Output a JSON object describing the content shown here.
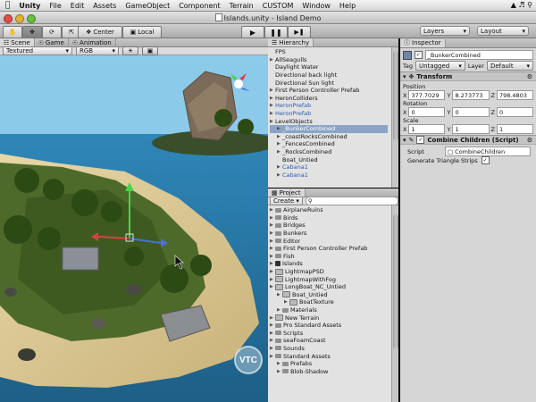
{
  "menubar": {
    "apple": "",
    "items": [
      "Unity",
      "File",
      "Edit",
      "Assets",
      "GameObject",
      "Component",
      "Terrain",
      "CUSTOM",
      "Window",
      "Help"
    ],
    "right_status": "◂ ▸ ◉"
  },
  "window": {
    "title": "Islands.unity - Island Demo"
  },
  "toolbar": {
    "pivot_label": "Center",
    "space_label": "Local",
    "layers_label": "Layers",
    "layout_label": "Layout"
  },
  "scene_panel": {
    "tabs": [
      "Scene",
      "Game",
      "Animation"
    ],
    "render_mode": "Textured",
    "color_mode": "RGB",
    "watermark": "VTC"
  },
  "hierarchy": {
    "title": "Hierarchy",
    "rows": [
      {
        "label": "FPS",
        "indent": 0,
        "arrow": false,
        "blue": false,
        "selected": false
      },
      {
        "label": "AllSeagulls",
        "indent": 0,
        "arrow": true,
        "blue": false,
        "selected": false
      },
      {
        "label": "Daylight Water",
        "indent": 0,
        "arrow": false,
        "blue": false,
        "selected": false
      },
      {
        "label": "Directional back light",
        "indent": 0,
        "arrow": false,
        "blue": false,
        "selected": false
      },
      {
        "label": "Directional Sun light",
        "indent": 0,
        "arrow": false,
        "blue": false,
        "selected": false
      },
      {
        "label": "First Person Controller Prefab",
        "indent": 0,
        "arrow": true,
        "blue": false,
        "selected": false
      },
      {
        "label": "HeronColliders",
        "indent": 0,
        "arrow": true,
        "blue": false,
        "selected": false
      },
      {
        "label": "HeronPrefab",
        "indent": 0,
        "arrow": true,
        "blue": true,
        "selected": false
      },
      {
        "label": "HeronPrefab",
        "indent": 0,
        "arrow": true,
        "blue": true,
        "selected": false
      },
      {
        "label": "LevelObjects",
        "indent": 0,
        "arrow": true,
        "blue": false,
        "selected": false
      },
      {
        "label": "_BunkerCombined",
        "indent": 1,
        "arrow": true,
        "blue": false,
        "selected": true
      },
      {
        "label": "_coastRocksCombined",
        "indent": 1,
        "arrow": true,
        "blue": false,
        "selected": false
      },
      {
        "label": "_FencesCombined",
        "indent": 1,
        "arrow": true,
        "blue": false,
        "selected": false
      },
      {
        "label": "_RocksCombined",
        "indent": 1,
        "arrow": true,
        "blue": false,
        "selected": false
      },
      {
        "label": "Boat_Untied",
        "indent": 1,
        "arrow": false,
        "blue": false,
        "selected": false
      },
      {
        "label": "Cabana1",
        "indent": 1,
        "arrow": true,
        "blue": true,
        "selected": false
      },
      {
        "label": "Cabana1",
        "indent": 1,
        "arrow": true,
        "blue": true,
        "selected": false
      }
    ]
  },
  "project": {
    "title": "Project",
    "create_label": "Create",
    "rows": [
      {
        "label": "AirplaneRuins",
        "indent": 0,
        "kind": "folder"
      },
      {
        "label": "Birds",
        "indent": 0,
        "kind": "folder"
      },
      {
        "label": "Bridges",
        "indent": 0,
        "kind": "folder"
      },
      {
        "label": "Bunkers",
        "indent": 0,
        "kind": "folder"
      },
      {
        "label": "Editor",
        "indent": 0,
        "kind": "folder"
      },
      {
        "label": "First Person Controller Prefab",
        "indent": 0,
        "kind": "folder"
      },
      {
        "label": "Fish",
        "indent": 0,
        "kind": "folder"
      },
      {
        "label": "Islands",
        "indent": 0,
        "kind": "scene"
      },
      {
        "label": "LightmapPSD",
        "indent": 0,
        "kind": "file"
      },
      {
        "label": "LightmapWithFog",
        "indent": 0,
        "kind": "file"
      },
      {
        "label": "LongBoat_NC_Untied",
        "indent": 0,
        "kind": "file"
      },
      {
        "label": "Boat_Untied",
        "indent": 1,
        "kind": "file"
      },
      {
        "label": "BoatTexture",
        "indent": 2,
        "kind": "file"
      },
      {
        "label": "Materials",
        "indent": 1,
        "kind": "folder"
      },
      {
        "label": "New Terrain",
        "indent": 0,
        "kind": "file"
      },
      {
        "label": "Pro Standard Assets",
        "indent": 0,
        "kind": "folder"
      },
      {
        "label": "Scripts",
        "indent": 0,
        "kind": "folder"
      },
      {
        "label": "seaFoamCoast",
        "indent": 0,
        "kind": "folder"
      },
      {
        "label": "Sounds",
        "indent": 0,
        "kind": "folder"
      },
      {
        "label": "Standard Assets",
        "indent": 0,
        "kind": "folder"
      },
      {
        "label": "Prefabs",
        "indent": 1,
        "kind": "folder"
      },
      {
        "label": "Blob-Shadow",
        "indent": 1,
        "kind": "folder"
      }
    ]
  },
  "inspector": {
    "title": "Inspector",
    "object_name": "_BunkerCombined",
    "tag_label": "Tag",
    "tag_value": "Untagged",
    "layer_label": "Layer",
    "layer_value": "Default",
    "transform": {
      "title": "Transform",
      "position_label": "Position",
      "rotation_label": "Rotation",
      "scale_label": "Scale",
      "position": {
        "x": "377.7029",
        "y": "8.273773",
        "z": "798.4803"
      },
      "rotation": {
        "x": "0",
        "y": "0",
        "z": "0"
      },
      "scale": {
        "x": "1",
        "y": "1",
        "z": "1"
      }
    },
    "component": {
      "title": "Combine Children (Script)",
      "script_label": "Script",
      "script_value": "CombineChildren",
      "strips_label": "Generate Triangle Strips"
    }
  }
}
